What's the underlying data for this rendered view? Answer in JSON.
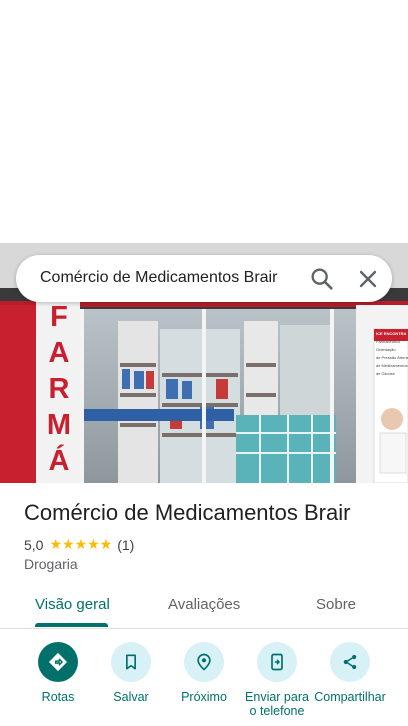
{
  "search": {
    "query": "Comércio de Medicamentos Brair",
    "search_icon": "search-icon",
    "close_icon": "close-icon"
  },
  "photo": {
    "sign_letters": "FARMÁ",
    "poster_heading": "ICE ENCONTRA",
    "poster_lines": [
      "Farmacêutico",
      "Orientação",
      "de Pressão Arterial",
      "de Medicamentos",
      "de Glicose"
    ]
  },
  "place": {
    "title": "Comércio de Medicamentos Brair",
    "rating": "5,0",
    "stars": "★★★★★",
    "review_count": "(1)",
    "category": "Drogaria"
  },
  "tabs": [
    {
      "label": "Visão geral",
      "active": true
    },
    {
      "label": "Avaliações",
      "active": false
    },
    {
      "label": "Sobre",
      "active": false
    }
  ],
  "actions": [
    {
      "label": "Rotas",
      "icon": "directions-icon"
    },
    {
      "label": "Salvar",
      "icon": "bookmark-icon"
    },
    {
      "label": "Próximo",
      "icon": "nearby-icon"
    },
    {
      "label": "Enviar para o telefone",
      "icon": "send-to-phone-icon"
    },
    {
      "label": "Compartilhar",
      "icon": "share-icon"
    }
  ],
  "colors": {
    "accent": "#00706b",
    "action_bg": "#d7f1f6",
    "star": "#fbbc04"
  }
}
